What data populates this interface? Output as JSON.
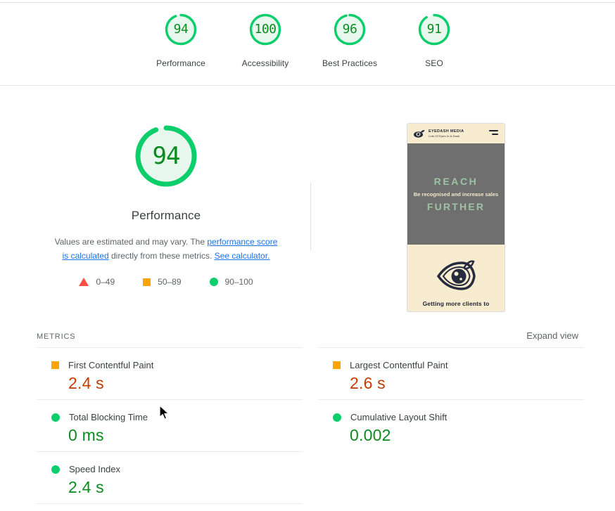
{
  "category_scores": [
    {
      "score": "94",
      "label": "Performance",
      "pct": 94,
      "color": "#0cce6b"
    },
    {
      "score": "100",
      "label": "Accessibility",
      "pct": 100,
      "color": "#0cce6b"
    },
    {
      "score": "96",
      "label": "Best Practices",
      "pct": 96,
      "color": "#0cce6b"
    },
    {
      "score": "91",
      "label": "SEO",
      "pct": 91,
      "color": "#0cce6b"
    }
  ],
  "performance": {
    "score": "94",
    "title": "Performance",
    "description_part1": "Values are estimated and may vary. The ",
    "link1": "performance score is calculated",
    "description_part2": " directly from these metrics. ",
    "link2": "See calculator."
  },
  "legend": [
    {
      "shape": "triangle",
      "range": "0–49",
      "color": "#ff4e42"
    },
    {
      "shape": "square",
      "range": "50–89",
      "color": "#ffa400"
    },
    {
      "shape": "circle",
      "range": "90–100",
      "color": "#0cce6b"
    }
  ],
  "thumbnail": {
    "brand_line1": "EYEDASH MEDIA",
    "brand_line2": "Lots Of Eyes In A Dash",
    "hero_title_top": "REACH",
    "hero_subtitle": "Be recognised and increase sales",
    "hero_title_bottom": "FURTHER",
    "caption": "Getting more clients to"
  },
  "metrics_section": {
    "title": "METRICS",
    "expand_label": "Expand view"
  },
  "metrics_left": [
    {
      "name": "First Contentful Paint",
      "value": "2.4 s",
      "status": "average"
    },
    {
      "name": "Total Blocking Time",
      "value": "0 ms",
      "status": "pass"
    },
    {
      "name": "Speed Index",
      "value": "2.4 s",
      "status": "pass"
    }
  ],
  "metrics_right": [
    {
      "name": "Largest Contentful Paint",
      "value": "2.6 s",
      "status": "average"
    },
    {
      "name": "Cumulative Layout Shift",
      "value": "0.002",
      "status": "pass"
    }
  ],
  "colors": {
    "pass": "#0cce6b",
    "average": "#ffa400",
    "fail": "#ff4e42",
    "value_average": "#c33d00",
    "value_pass": "#0a8c1f",
    "link": "#1a73e8"
  }
}
